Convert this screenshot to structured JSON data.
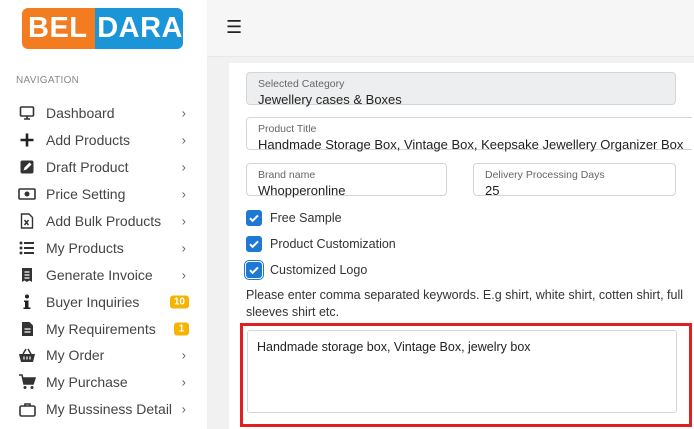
{
  "brand": {
    "part1": "BEL",
    "part2": "DARA",
    "color1": "#f47c20",
    "color2": "#1a95d7"
  },
  "topbar": {
    "menu_icon": "☰"
  },
  "nav": {
    "heading": "NAVIGATION",
    "items": [
      {
        "label": "Dashboard",
        "icon": "monitor-icon",
        "chevron": "›"
      },
      {
        "label": "Add Products",
        "icon": "plus-icon",
        "chevron": "›"
      },
      {
        "label": "Draft Product",
        "icon": "edit-icon",
        "chevron": "›"
      },
      {
        "label": "Price Setting",
        "icon": "money-icon",
        "chevron": "›"
      },
      {
        "label": "Add Bulk Products",
        "icon": "excel-file-icon",
        "chevron": "›"
      },
      {
        "label": "My Products",
        "icon": "list-icon",
        "chevron": "›"
      },
      {
        "label": "Generate Invoice",
        "icon": "receipt-icon",
        "chevron": "›"
      },
      {
        "label": "Buyer Inquiries",
        "icon": "info-icon",
        "badge": "10"
      },
      {
        "label": "My Requirements",
        "icon": "document-icon",
        "badge": "1"
      },
      {
        "label": "My Order",
        "icon": "basket-icon",
        "chevron": "›"
      },
      {
        "label": "My Purchase",
        "icon": "cart-icon",
        "chevron": "›"
      },
      {
        "label": "My Bussiness Detail",
        "icon": "briefcase-icon",
        "chevron": "›"
      }
    ],
    "badge_color": "#f4b400"
  },
  "form": {
    "selected_category": {
      "label": "Selected Category",
      "value": "Jewellery cases & Boxes"
    },
    "product_title": {
      "label": "Product Title",
      "value": "Handmade Storage Box, Vintage Box, Keepsake Jewellery Organizer Box"
    },
    "brand_name": {
      "label": "Brand name",
      "value": "Whopperonline"
    },
    "delivery_days": {
      "label": "Delivery Processing Days",
      "value": "25"
    },
    "checkboxes": {
      "free_sample": "Free Sample",
      "customization": "Product Customization",
      "customized_logo": "Customized Logo"
    },
    "keywords_hint": "Please enter comma separated keywords. E.g shirt, white shirt, cotten shirt, full sleeves shirt etc.",
    "keywords_value": "Handmade storage box, Vintage Box, jewelry box"
  },
  "colors": {
    "accent": "#1f78d1",
    "highlight": "#e0201f"
  }
}
